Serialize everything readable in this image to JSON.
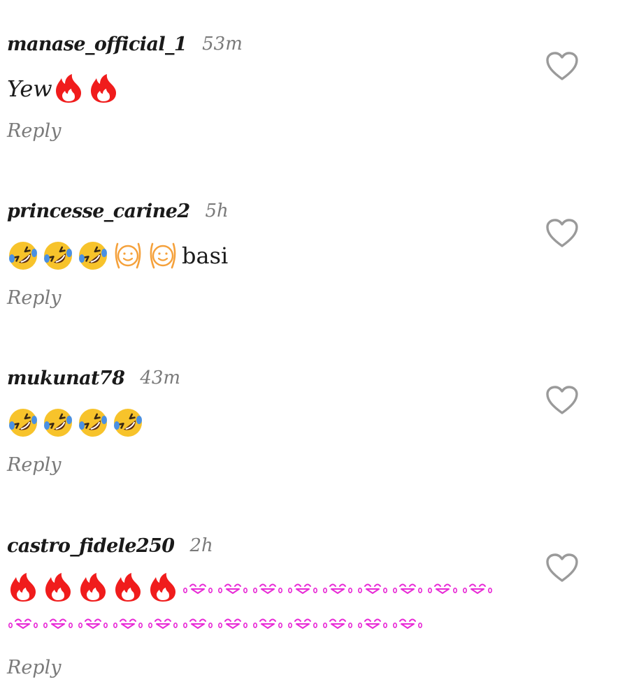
{
  "comments": [
    {
      "username": "manase_official_1",
      "time": "53m",
      "text_before": "Yew",
      "emojis": [
        "fire-icon",
        "fire-icon"
      ],
      "text_after": "",
      "reply_label": "Reply"
    },
    {
      "username": "princesse_carine2",
      "time": "5h",
      "text_before": "",
      "emojis": [
        "rofl-icon",
        "rofl-icon",
        "rofl-icon",
        "hands-on-cheeks-icon",
        "hands-on-cheeks-icon"
      ],
      "text_after": "basi",
      "reply_label": "Reply"
    },
    {
      "username": "mukunat78",
      "time": "43m",
      "text_before": "",
      "emojis": [
        "rofl-icon",
        "rofl-icon",
        "rofl-icon",
        "rofl-icon"
      ],
      "text_after": "",
      "reply_label": "Reply"
    },
    {
      "username": "castro_fidele250",
      "time": "2h",
      "text_before": "",
      "emojis": [
        "fire-icon",
        "fire-icon",
        "fire-icon",
        "fire-icon",
        "fire-icon",
        "tears-kaomoji-icon",
        "tears-kaomoji-icon",
        "tears-kaomoji-icon",
        "tears-kaomoji-icon",
        "tears-kaomoji-icon",
        "tears-kaomoji-icon",
        "tears-kaomoji-icon",
        "tears-kaomoji-icon",
        "tears-kaomoji-icon",
        "tears-kaomoji-icon",
        "tears-kaomoji-icon",
        "tears-kaomoji-icon",
        "tears-kaomoji-icon",
        "tears-kaomoji-icon",
        "tears-kaomoji-icon",
        "tears-kaomoji-icon",
        "tears-kaomoji-icon",
        "tears-kaomoji-icon",
        "tears-kaomoji-icon",
        "tears-kaomoji-icon",
        "tears-kaomoji-icon"
      ],
      "text_after": "",
      "reply_label": "Reply"
    }
  ],
  "colors": {
    "username": "#1a1a1a",
    "meta_gray": "#7a7a7a",
    "fire_red": "#f01c1c",
    "rofl_yellow": "#f7c32b",
    "hands_orange": "#f5a13b",
    "kaomoji_magenta": "#e82ad6",
    "heart_gray": "#9a9a9a"
  }
}
